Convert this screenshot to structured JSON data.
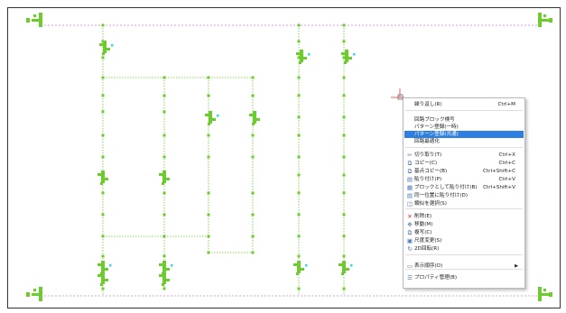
{
  "colors": {
    "component": "#6ccb2d",
    "guide_line": "#6ccb2d",
    "boundary_line": "#e07ad8",
    "selection_cyan": "#37d5e8",
    "cursor_red": "#e23b3b",
    "menu_highlight": "#2f7fe0"
  },
  "context_menu": {
    "items": [
      {
        "label": "繰り返し(R)",
        "shortcut": "Ctrl+M",
        "icon": ""
      },
      {
        "label": "回路ブロック検写",
        "shortcut": "",
        "icon": ""
      },
      {
        "label": "パターン登録(一時)",
        "shortcut": "",
        "icon": ""
      },
      {
        "label": "パターン登録(共通)",
        "shortcut": "",
        "icon": "",
        "highlighted": true
      },
      {
        "label": "回路最適化",
        "shortcut": "",
        "icon": ""
      },
      {
        "label": "切り取り(T)",
        "shortcut": "Ctrl+X",
        "icon": "scissors-icon"
      },
      {
        "label": "コピー(C)",
        "shortcut": "Ctrl+C",
        "icon": "copy-icon"
      },
      {
        "label": "基点コピー(B)",
        "shortcut": "Ctrl+Shift+C",
        "icon": "base-copy-icon"
      },
      {
        "label": "貼り付け(P)",
        "shortcut": "Ctrl+V",
        "icon": "paste-icon"
      },
      {
        "label": "ブロックとして貼り付け(B)",
        "shortcut": "Ctrl+Shift+V",
        "icon": "paste-block-icon"
      },
      {
        "label": "同一位置に貼り付け(D)",
        "shortcut": "",
        "icon": "paste-same-position-icon"
      },
      {
        "label": "類似を選択(S)",
        "shortcut": "",
        "icon": "select-similar-icon"
      },
      {
        "label": "削除(E)",
        "shortcut": "",
        "icon": "delete-icon"
      },
      {
        "label": "移動(M)",
        "shortcut": "",
        "icon": "move-icon"
      },
      {
        "label": "複写(C)",
        "shortcut": "",
        "icon": "duplicate-icon"
      },
      {
        "label": "尺度変更(S)",
        "shortcut": "",
        "icon": "scale-icon"
      },
      {
        "label": "2D回転(R)",
        "shortcut": "",
        "icon": "rotate-icon"
      },
      {
        "label": "表示順序(O)",
        "shortcut": "",
        "icon": "display-order-icon",
        "submenu": true
      },
      {
        "label": "プロパティ管理(B)",
        "shortcut": "",
        "icon": "properties-icon"
      }
    ]
  }
}
